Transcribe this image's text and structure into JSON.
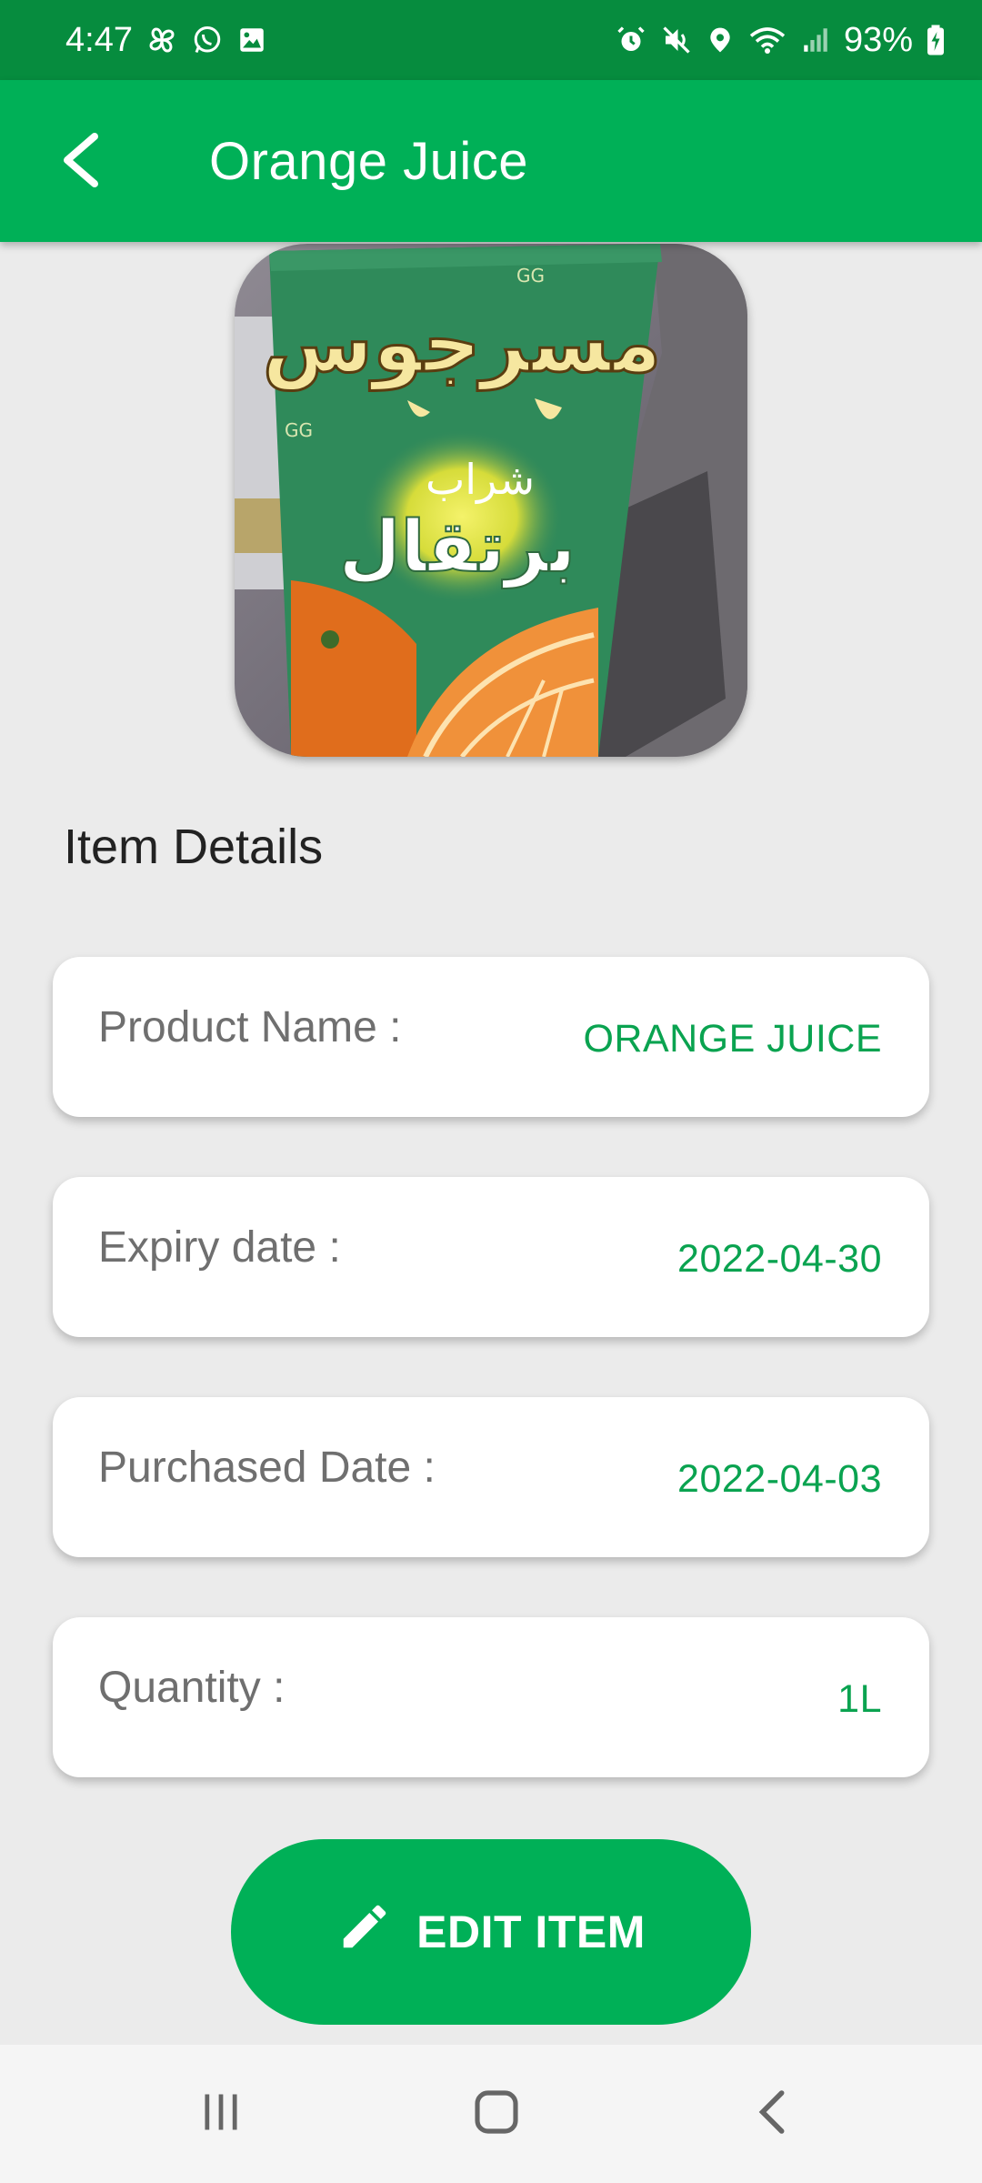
{
  "status_bar": {
    "time": "4:47",
    "battery": "93%",
    "left_icons": [
      "pinwheel-icon",
      "whatsapp-icon",
      "gallery-icon"
    ],
    "right_icons": [
      "alarm-icon",
      "mute-icon",
      "location-icon",
      "wifi-icon",
      "signal-icon",
      "battery-charging-icon"
    ]
  },
  "app_bar": {
    "title": "Orange Juice",
    "back_icon": "arrow-left-icon"
  },
  "section": {
    "heading": "Item Details"
  },
  "details": [
    {
      "label": "Product Name :",
      "value": "ORANGE JUICE"
    },
    {
      "label": "Expiry date :",
      "value": "2022-04-30"
    },
    {
      "label": "Purchased Date :",
      "value": "2022-04-03"
    },
    {
      "label": "Quantity :",
      "value": "1L"
    }
  ],
  "edit_button": {
    "label": "EDIT ITEM",
    "icon": "pencil-icon"
  },
  "photo_brand": {
    "brand": "مسرجوس",
    "drink": "شراب",
    "flavor": "برتقال",
    "mark": "GG"
  },
  "nav_bar": {
    "icons": [
      "recent-apps-icon",
      "home-icon",
      "back-icon"
    ]
  },
  "colors": {
    "status_bar": "#068c3e",
    "app_bar": "#00b057",
    "value_text": "#0aa350",
    "background": "#ebebeb"
  }
}
